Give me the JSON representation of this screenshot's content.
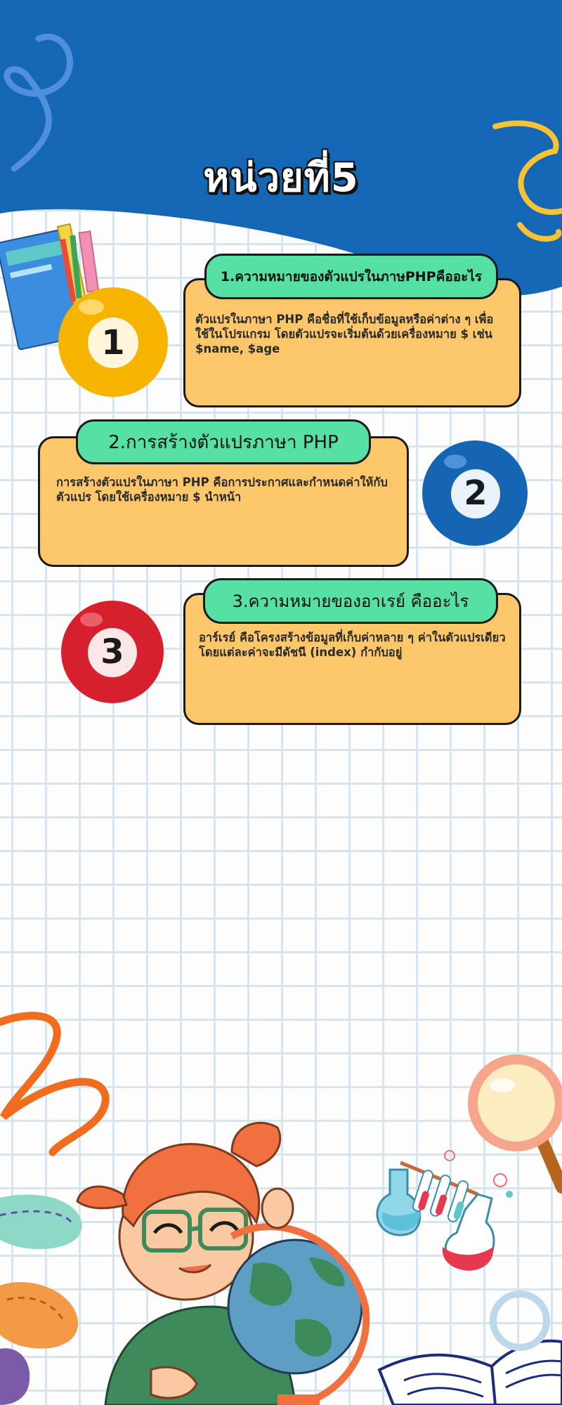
{
  "page": {
    "title": "หน่วยที่5"
  },
  "sections": [
    {
      "number": "1",
      "heading": "1.ความหมายของตัวแปรในภาษPHPคืออะไร",
      "body": "ตัวแปรในภาษา PHP คือชื่อที่ใช้เก็บข้อมูลหรือค่าต่าง ๆ เพื่อใช้ในโปรแกรม โดยตัวแปรจะเริ่มต้นด้วยเครื่องหมาย $ เช่น $name, $age",
      "ball_color": "#f6b400"
    },
    {
      "number": "2",
      "heading": "2.การสร้างตัวแปรภาษา PHP",
      "body": "การสร้างตัวแปรในภาษา PHP คือการประกาศและกำหนดค่าให้กับตัวแปร โดยใช้เครื่องหมาย $ นำหน้า",
      "ball_color": "#1565b3"
    },
    {
      "number": "3",
      "heading": "3.ความหมายของอาเรย์ คืออะไร",
      "body": "อาร์เรย์ คือโครงสร้างข้อมูลที่เก็บค่าหลาย ๆ ค่าในตัวแปรเดียว โดยแต่ละค่าจะมีดัชนี (index) กำกับอยู่",
      "ball_color": "#d6202d"
    }
  ],
  "colors": {
    "header_blue": "#1467b4",
    "card_fill": "#fcc76b",
    "pill_fill": "#56e0a4",
    "grid_line": "#d5e6ee"
  },
  "decor": [
    "books-pencils-illustration",
    "kid-with-globe-illustration",
    "lab-flasks-illustration",
    "magnifying-glass-illustration",
    "open-book-illustration",
    "squiggle-shapes"
  ]
}
